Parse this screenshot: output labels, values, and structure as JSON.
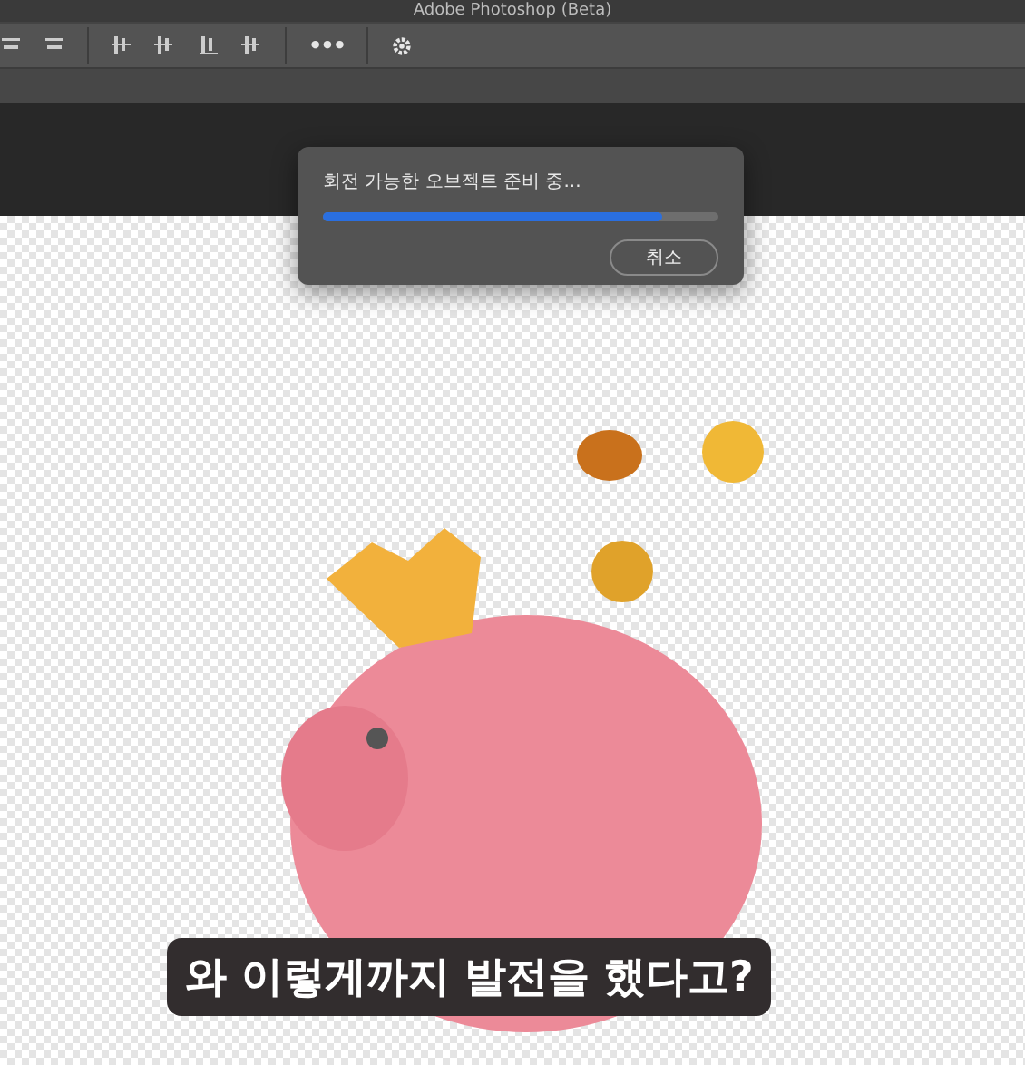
{
  "window": {
    "title": "Adobe Photoshop (Beta)"
  },
  "toolbar": {
    "more_label": "•••"
  },
  "dialog": {
    "message": "회전 가능한 오브젝트 준비 중...",
    "progress": {
      "level": 0.86
    },
    "buttons": [
      "취소"
    ]
  },
  "subtitle": "와 이렇게까지 발전을 했다고?"
}
